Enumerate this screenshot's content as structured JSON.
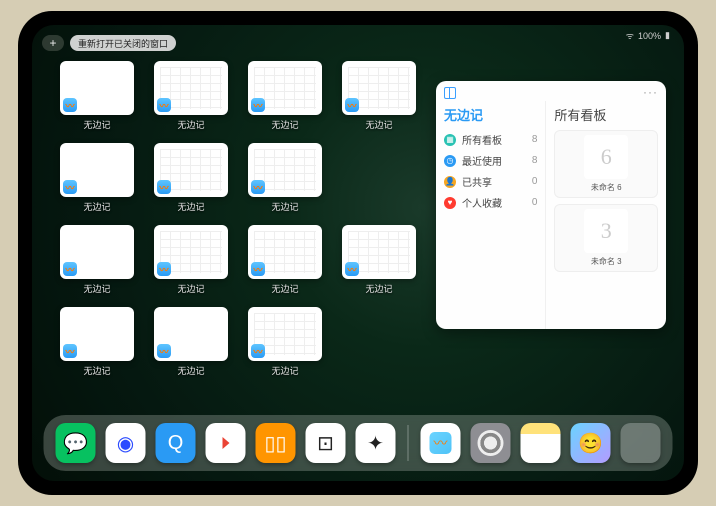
{
  "status": {
    "battery": "100%"
  },
  "top": {
    "plus_label": "+",
    "reopen_label": "重新打开已关闭的窗口"
  },
  "tile_label": "无边记",
  "tiles": [
    {
      "variant": "blank"
    },
    {
      "variant": "cal"
    },
    {
      "variant": "cal"
    },
    {
      "variant": "cal"
    },
    {
      "variant": "blank"
    },
    {
      "variant": "cal"
    },
    {
      "variant": "cal"
    },
    {
      "hidden": true
    },
    {
      "variant": "blank"
    },
    {
      "variant": "cal"
    },
    {
      "variant": "cal"
    },
    {
      "variant": "cal"
    },
    {
      "variant": "blank"
    },
    {
      "variant": "blank"
    },
    {
      "variant": "cal"
    },
    {
      "hidden": true
    }
  ],
  "panel": {
    "left_title": "无边记",
    "right_title": "所有看板",
    "categories": [
      {
        "icon": "grid",
        "color": "#29c2b3",
        "label": "所有看板",
        "count": "8"
      },
      {
        "icon": "clock",
        "color": "#2a9af4",
        "label": "最近使用",
        "count": "8"
      },
      {
        "icon": "person",
        "color": "#f5a623",
        "label": "已共享",
        "count": "0"
      },
      {
        "icon": "heart",
        "color": "#ff3b30",
        "label": "个人收藏",
        "count": "0"
      }
    ],
    "cards": [
      {
        "glyph": "6",
        "caption": "未命名 6",
        "sub": ""
      },
      {
        "glyph": "3",
        "caption": "未命名 3",
        "sub": ""
      }
    ]
  },
  "dock": [
    {
      "name": "wechat",
      "title": "WeChat"
    },
    {
      "name": "browser1",
      "title": "Browser"
    },
    {
      "name": "browser2",
      "title": "QQ Browser"
    },
    {
      "name": "play",
      "title": "Play"
    },
    {
      "name": "books",
      "title": "Books"
    },
    {
      "name": "dots",
      "title": "App"
    },
    {
      "name": "graph",
      "title": "App"
    },
    {
      "sep": true
    },
    {
      "name": "freeform",
      "title": "Freeform"
    },
    {
      "name": "settings",
      "title": "Settings"
    },
    {
      "name": "notes",
      "title": "Notes"
    },
    {
      "name": "memoji",
      "title": "Memoji"
    },
    {
      "name": "folder",
      "title": "Folder"
    }
  ]
}
